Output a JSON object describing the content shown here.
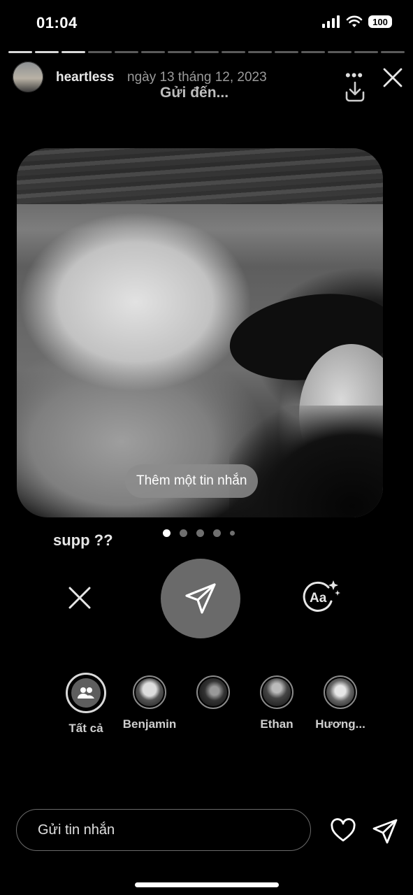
{
  "status": {
    "time": "01:04",
    "battery": "100"
  },
  "story": {
    "username": "heartless",
    "date": "ngày 13 tháng 12, 2023",
    "progress_segments": 15,
    "progress_done": 3
  },
  "share": {
    "title": "Gửi đến...",
    "add_message": "Thêm một tin nhắn",
    "caption": "supp ??",
    "page_dots": 5,
    "active_dot": 0,
    "recipients": [
      {
        "name": "Tất cả",
        "selected": true
      },
      {
        "name": "Benjamin"
      },
      {
        "name": ""
      },
      {
        "name": "Ethan"
      },
      {
        "name": "Hương..."
      }
    ]
  },
  "composer": {
    "placeholder": "Gửi tin nhắn"
  },
  "icons": {
    "download": "download-icon",
    "close": "close-icon",
    "send": "paper-plane-icon",
    "text_style": "aa-sparkle-icon",
    "heart": "heart-icon"
  }
}
